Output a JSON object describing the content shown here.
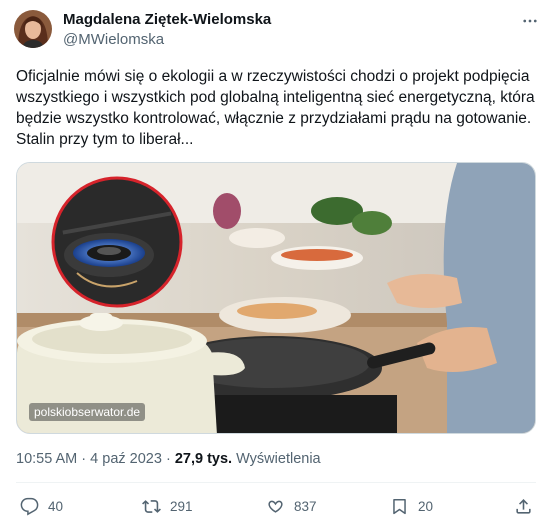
{
  "author": {
    "name": "Magdalena Ziętek-Wielomska",
    "handle": "@MWielomska"
  },
  "tweet": {
    "text": "Oficjalnie mówi się o ekologii a w rzeczywistości chodzi o projekt podpięcia wszystkiego i wszystkich pod globalną inteligentną sieć energetyczną, która będzie wszystko kontrolować, włącznie z przydziałami prądu na gotowanie. Stalin przy tym to liberał..."
  },
  "media": {
    "watermark": "polskiobserwator.de"
  },
  "meta": {
    "time": "10:55 AM",
    "separator": "·",
    "date": "4 paź 2023",
    "views_count": "27,9 tys.",
    "views_label": "Wyświetlenia"
  },
  "actions": {
    "replies": "40",
    "reposts": "291",
    "likes": "837",
    "bookmarks": "20"
  },
  "icons": [
    "more-icon",
    "reply-icon",
    "repost-icon",
    "like-icon",
    "bookmark-icon",
    "share-icon"
  ],
  "colors": {
    "text": "#0f1419",
    "secondary": "#536471",
    "border": "#cfd9de",
    "divider": "#eff3f4"
  }
}
